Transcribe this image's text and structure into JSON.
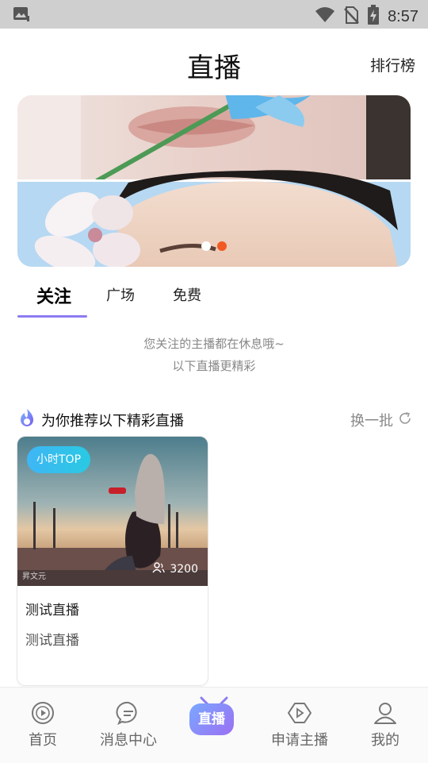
{
  "status_bar": {
    "time": "8:57",
    "icons": [
      "image-notification-icon",
      "wifi-icon",
      "no-sim-icon",
      "battery-charging-icon"
    ]
  },
  "header": {
    "title": "直播",
    "ranking_label": "排行榜"
  },
  "banner": {
    "slide_count": 2,
    "active_index": 1,
    "accent": "#f15a24"
  },
  "tabs": [
    {
      "label": "关注",
      "active": true
    },
    {
      "label": "广场",
      "active": false
    },
    {
      "label": "免费",
      "active": false
    }
  ],
  "empty_state": {
    "line1": "您关注的主播都在休息哦~",
    "line2": "以下直播更精彩"
  },
  "recommend": {
    "title": "为你推荐以下精彩直播",
    "refresh_label": "换一批"
  },
  "cards": [
    {
      "badge": "小时TOP",
      "viewers": "3200",
      "watermark": "昇文元",
      "name": "测试直播",
      "description": "测试直播"
    }
  ],
  "bottom_nav": [
    {
      "label": "首页",
      "icon": "home-play-icon"
    },
    {
      "label": "消息中心",
      "icon": "message-icon"
    },
    {
      "label": "直播",
      "icon": "live-tv-icon",
      "active": true
    },
    {
      "label": "申请主播",
      "icon": "apply-anchor-icon"
    },
    {
      "label": "我的",
      "icon": "profile-icon"
    }
  ],
  "colors": {
    "accent_purple": "#8c7cf0",
    "badge_blue": "#29c9e3",
    "status_bar_bg": "#cfcfcf"
  }
}
